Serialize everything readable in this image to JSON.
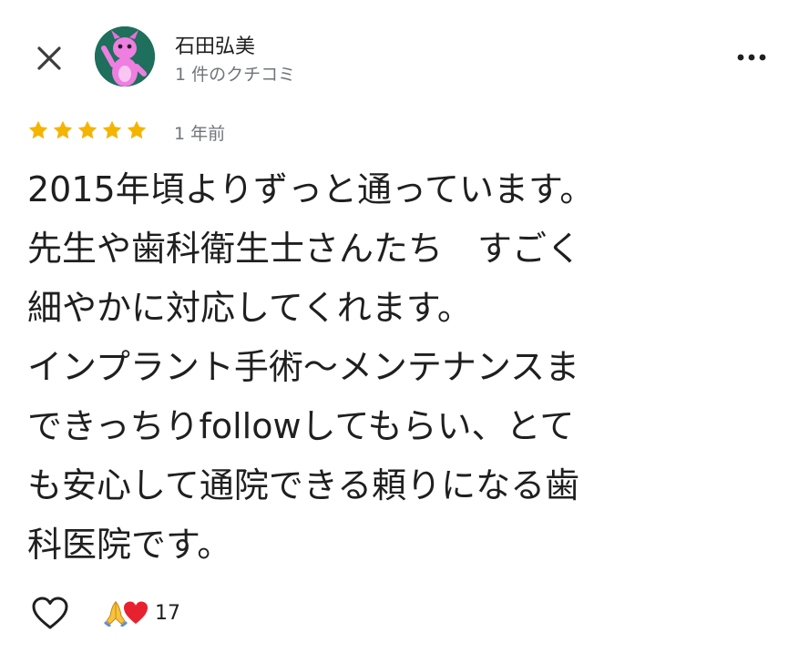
{
  "header": {
    "user_name": "石田弘美",
    "review_count": "1 件のクチコミ"
  },
  "review": {
    "rating": 5,
    "max_rating": 5,
    "time": "1 年前",
    "lines": [
      "2015年頃よりずっと通っています。",
      "先生や歯科衛生士さんたち　すごく",
      "細やかに対応してくれます。",
      "インプラント手術〜メンテナンスま",
      "できっちりfollowしてもらい、とて",
      "も安心して通院できる頼りになる歯",
      "科医院です。"
    ]
  },
  "reactions": {
    "icons": [
      "folded-hands-icon",
      "red-heart-icon"
    ],
    "count": "17"
  },
  "colors": {
    "star": "#f4b400",
    "secondary_text": "#70757a",
    "primary_text": "#1f1f1f",
    "heart": "#e8212f"
  }
}
